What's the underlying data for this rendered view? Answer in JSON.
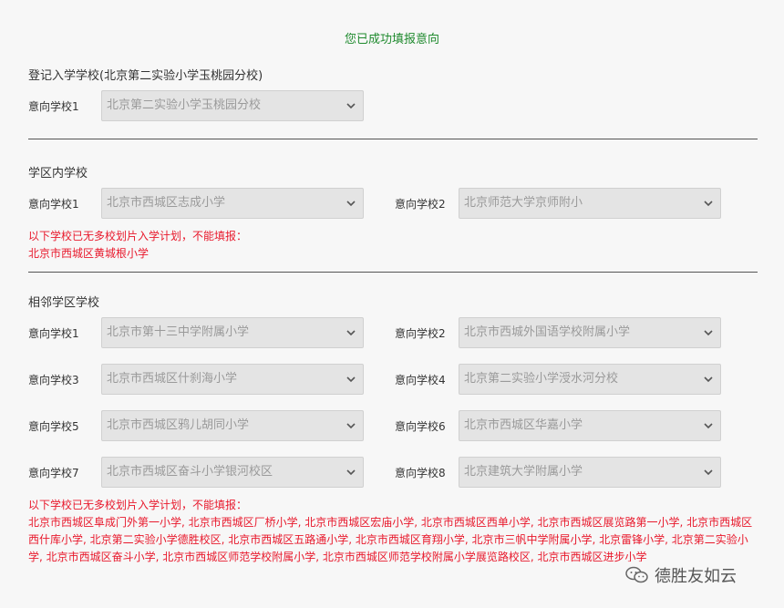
{
  "success_message": "您已成功填报意向",
  "registered_section": {
    "title": "登记入学学校(北京第二实验小学玉桃园分校)",
    "fields": [
      {
        "label": "意向学校1",
        "value": "北京第二实验小学玉桃园分校"
      }
    ]
  },
  "district_section": {
    "title": "学区内学校",
    "fields": [
      {
        "label": "意向学校1",
        "value": "北京市西城区志成小学"
      },
      {
        "label": "意向学校2",
        "value": "北京师范大学京师附小"
      }
    ],
    "warning_title": "以下学校已无多校划片入学计划，不能填报：",
    "warning_list": "北京市西城区黄城根小学"
  },
  "adjacent_section": {
    "title": "相邻学区学校",
    "fields": [
      {
        "label": "意向学校1",
        "value": "北京市第十三中学附属小学"
      },
      {
        "label": "意向学校2",
        "value": "北京市西城外国语学校附属小学"
      },
      {
        "label": "意向学校3",
        "value": "北京市西城区什刹海小学"
      },
      {
        "label": "意向学校4",
        "value": "北京第二实验小学涭水河分校"
      },
      {
        "label": "意向学校5",
        "value": "北京市西城区鸦儿胡同小学"
      },
      {
        "label": "意向学校6",
        "value": "北京市西城区华嘉小学"
      },
      {
        "label": "意向学校7",
        "value": "北京市西城区奋斗小学银河校区"
      },
      {
        "label": "意向学校8",
        "value": "北京建筑大学附属小学"
      }
    ],
    "warning_title": "以下学校已无多校划片入学计划，不能填报：",
    "warning_list": "北京市西城区阜成门外第一小学, 北京市西城区厂桥小学, 北京市西城区宏庙小学, 北京市西城区西单小学, 北京市西城区展览路第一小学, 北京市西城区西什库小学, 北京第二实验小学德胜校区, 北京市西城区五路通小学, 北京市西城区育翔小学, 北京市三帆中学附属小学, 北京雷锋小学, 北京第二实验小学, 北京市西城区奋斗小学, 北京市西城区师范学校附属小学, 北京市西城区师范学校附属小学展览路校区, 北京市西城区进步小学"
  },
  "watermark": {
    "icon": "wechat-channel-icon",
    "text": "德胜友如云"
  },
  "colors": {
    "success": "#1f8a2e",
    "warning": "#e8192c",
    "select_bg": "#e4e4e4",
    "select_text": "#9a9a9a"
  }
}
